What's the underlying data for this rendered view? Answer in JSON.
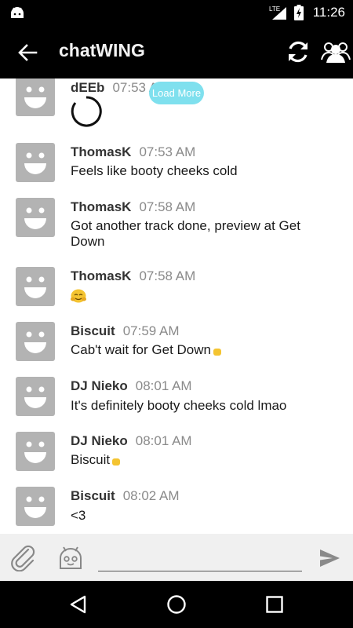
{
  "status_bar": {
    "network": "LTE",
    "time": "11:26"
  },
  "app_bar": {
    "title": "chatWING"
  },
  "load_more_label": "Load More",
  "messages": [
    {
      "user": "dEEb",
      "time": "07:53 AM",
      "text": ""
    },
    {
      "user": "ThomasK",
      "time": "07:53 AM",
      "text": "Feels like booty cheeks cold"
    },
    {
      "user": "ThomasK",
      "time": "07:58 AM",
      "text": "Got another track done, preview at Get Down"
    },
    {
      "user": "ThomasK",
      "time": "07:58 AM",
      "text": ""
    },
    {
      "user": "Biscuit",
      "time": "07:59 AM",
      "text": "Cab't wait for Get Down"
    },
    {
      "user": "DJ Nieko",
      "time": "08:01 AM",
      "text": "It's definitely booty cheeks cold lmao"
    },
    {
      "user": "DJ Nieko",
      "time": "08:01 AM",
      "text": "Biscuit"
    },
    {
      "user": "Biscuit",
      "time": "08:02 AM",
      "text": "<3"
    }
  ],
  "input": {
    "value": "",
    "placeholder": ""
  },
  "icons": {
    "back": "arrow-left-icon",
    "refresh": "refresh-icon",
    "users": "users-icon",
    "attach": "paperclip-icon",
    "emoji": "emoji-icon",
    "send": "send-icon"
  },
  "colors": {
    "app_bar": "#000000",
    "accent_load_more": "#7fe0ee",
    "avatar": "#b3b3b3"
  }
}
